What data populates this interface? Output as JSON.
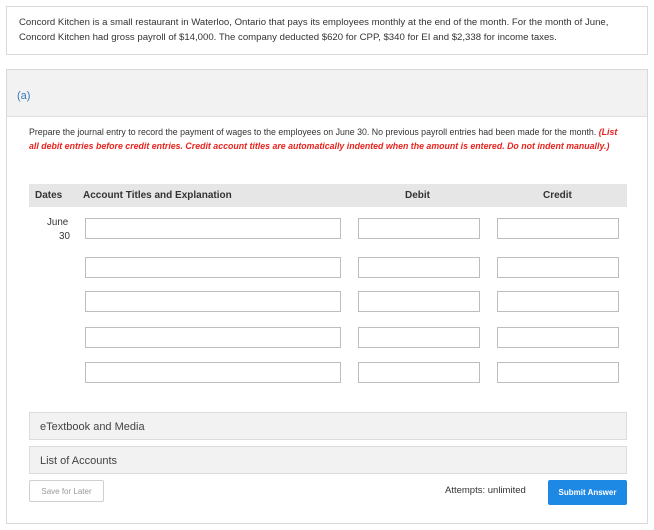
{
  "problem": {
    "text": "Concord Kitchen is a small restaurant in Waterloo, Ontario that pays its employees monthly at the end of the month. For the month of June, Concord Kitchen had gross payroll of $14,000. The company deducted $620 for CPP, $340 for EI and $2,338 for income taxes."
  },
  "part": {
    "label": "(a)",
    "instructions": "Prepare the journal entry to record the payment of wages to the employees on June 30. No previous payroll entries had been made for the month.",
    "note": "(List all debit entries before credit entries. Credit account titles are automatically indented when the amount is entered. Do not indent manually.)"
  },
  "table": {
    "headers": {
      "dates": "Dates",
      "account": "Account Titles and Explanation",
      "debit": "Debit",
      "credit": "Credit"
    },
    "date": {
      "month": "June",
      "day": "30"
    },
    "rows": [
      {
        "account": "",
        "debit": "",
        "credit": ""
      },
      {
        "account": "",
        "debit": "",
        "credit": ""
      },
      {
        "account": "",
        "debit": "",
        "credit": ""
      },
      {
        "account": "",
        "debit": "",
        "credit": ""
      },
      {
        "account": "",
        "debit": "",
        "credit": ""
      }
    ]
  },
  "links": {
    "etextbook": "eTextbook and Media",
    "accounts": "List of Accounts"
  },
  "footer": {
    "save_label": "Save for Later",
    "attempts": "Attempts: unlimited",
    "submit_label": "Submit Answer"
  },
  "colors": {
    "accent": "#1e88e5",
    "note_red": "#e8221d",
    "part_label": "#3a78b8"
  }
}
